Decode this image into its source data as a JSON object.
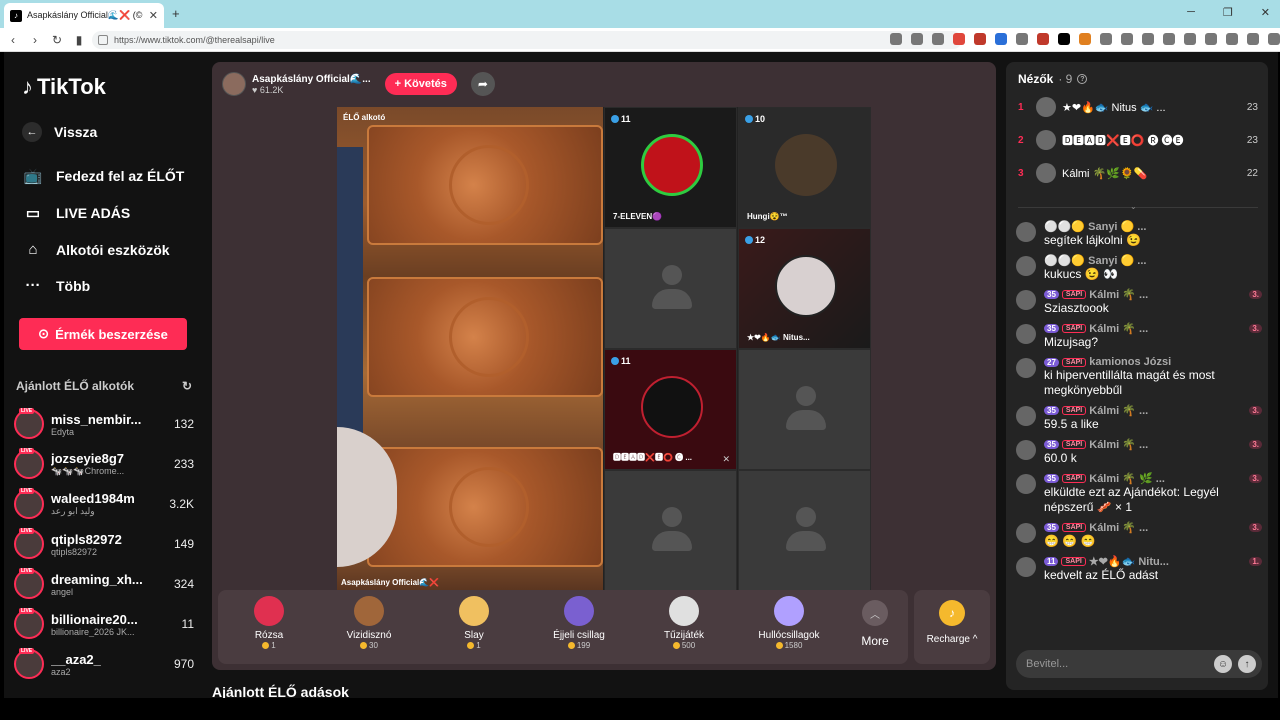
{
  "browser": {
    "tab_title": "Asapkáslány Official🌊❌ (©",
    "url": "https://www.tiktok.com/@therealsapi/live",
    "new_tab": "+",
    "win_min": "─",
    "win_max": "❐",
    "win_close": "✕"
  },
  "sidebar": {
    "logo": "TikTok",
    "back": "Vissza",
    "nav": [
      {
        "label": "Fedezd fel az ÉLŐT",
        "icon": "tv-icon"
      },
      {
        "label": "LIVE ADÁS",
        "icon": "camera-icon"
      },
      {
        "label": "Alkotói eszközök",
        "icon": "home-tool-icon"
      },
      {
        "label": "Több",
        "icon": "more-icon"
      }
    ],
    "coins_button": "Érmék beszerzése",
    "suggested_title": "Ajánlott ÉLŐ alkotók",
    "live_tag": "LIVE",
    "suggested": [
      {
        "name": "miss_nembir...",
        "sub": "Edyta",
        "count": "132"
      },
      {
        "name": "jozseyie8g7",
        "sub": "🐄🐄🐄Chrome...",
        "count": "233"
      },
      {
        "name": "waleed1984m",
        "sub": "وليد ابو رعد",
        "count": "3.2K"
      },
      {
        "name": "qtipls82972",
        "sub": "qtipls82972",
        "count": "149"
      },
      {
        "name": "dreaming_xh...",
        "sub": "angel",
        "count": "324"
      },
      {
        "name": "billionaire20...",
        "sub": "billionaire_2026 JK...",
        "count": "11"
      },
      {
        "name": "__aza2_",
        "sub": "aza2",
        "count": "970"
      }
    ]
  },
  "live": {
    "host_name": "Asapkáslány Official🌊...",
    "host_likes": "♥ 61.2K",
    "follow": "+ Követés",
    "elo_label": "ÉLŐ alkotó",
    "host_label": "Asapkáslány Official🌊❌",
    "tiles": [
      {
        "badge": "11",
        "label": "7-ELEVEN🟣"
      },
      {
        "badge": "10",
        "label": "Hungi😵™"
      },
      {
        "badge": "12",
        "label": "★❤🔥🐟 Nitus..."
      },
      {
        "badge": "11",
        "label": "🅳🅴🅰🅳❌🅴⭕ 🅒 ..."
      }
    ],
    "gifts": [
      {
        "name": "Rózsa",
        "price": "1",
        "color": "#e03050"
      },
      {
        "name": "Vizidisznó",
        "price": "30",
        "color": "#a0663a"
      },
      {
        "name": "Slay",
        "price": "1",
        "color": "#f0c060"
      },
      {
        "name": "Éjjeli csillag",
        "price": "199",
        "color": "#7a60d0"
      },
      {
        "name": "Tűzijáték",
        "price": "500",
        "color": "#e0e0e0"
      },
      {
        "name": "Hullócsillagok",
        "price": "1580",
        "color": "#b0a0ff"
      }
    ],
    "more": "More",
    "recharge": "Recharge ^"
  },
  "bottom_title": "Ajánlott ÉLŐ adások",
  "viewers": {
    "title": "Nézők",
    "count": "· 9",
    "list": [
      {
        "rank": "1",
        "name": "★❤🔥🐟 Nitus 🐟 ...",
        "score": "23"
      },
      {
        "rank": "2",
        "name": "🅳🅴🅰🅳❌🅴⭕ 🅡 🅒🅔",
        "score": "23"
      },
      {
        "rank": "3",
        "name": "Kálmi 🌴🌿🌻💊",
        "score": "22"
      }
    ]
  },
  "chat": [
    {
      "lvl": "",
      "tag": "",
      "user": "⚪⚪🟡 Sanyi 🟡 ...",
      "fan": "",
      "text": "segítek lájkolni 😉"
    },
    {
      "lvl": "",
      "tag": "",
      "user": "⚪⚪🟡 Sanyi 🟡 ...",
      "fan": "",
      "text": "kukucs 😉 👀"
    },
    {
      "lvl": "35",
      "tag": "SAPI",
      "user": "Kálmi 🌴 ...",
      "fan": "3.",
      "text": "Sziasztoook"
    },
    {
      "lvl": "35",
      "tag": "SAPI",
      "user": "Kálmi 🌴 ...",
      "fan": "3.",
      "text": "Mizujsag?"
    },
    {
      "lvl": "27",
      "tag": "SAPI",
      "user": "kamionos Józsi",
      "fan": "",
      "text": "ki hiperventillálta magát és most megkönyebbűl"
    },
    {
      "lvl": "35",
      "tag": "SAPI",
      "user": "Kálmi 🌴 ...",
      "fan": "3.",
      "text": "59.5 a like"
    },
    {
      "lvl": "35",
      "tag": "SAPI",
      "user": "Kálmi 🌴 ...",
      "fan": "3.",
      "text": "60.0 k"
    },
    {
      "lvl": "35",
      "tag": "SAPI",
      "user": "Kálmi 🌴 🌿 ...",
      "fan": "3.",
      "text": "elküldte ezt az Ajándékot: Legyél népszerű 🥓 × 1"
    },
    {
      "lvl": "35",
      "tag": "SAPI",
      "user": "Kálmi 🌴 ...",
      "fan": "3.",
      "text": "😁 😁 😁"
    },
    {
      "lvl": "11",
      "tag": "SAPI",
      "user": "★❤🔥🐟 Nitu...",
      "fan": "1.",
      "text": "kedvelt az ÉLŐ adást"
    }
  ],
  "input": {
    "placeholder": "Bevitel..."
  }
}
